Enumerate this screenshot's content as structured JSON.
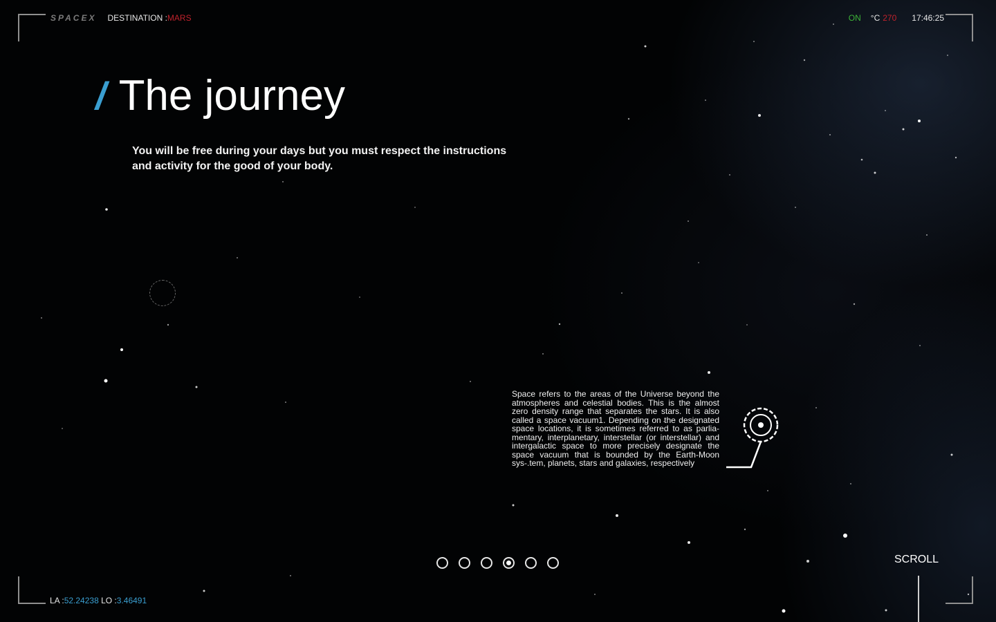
{
  "header": {
    "logo": "SPACEX",
    "destination_label": "DESTINATION :",
    "destination_value": "MARS",
    "status": "ON",
    "temp_unit": "°C",
    "temp_value": "270",
    "time": "17:46:25"
  },
  "hero": {
    "slash": "/",
    "title": "The journey",
    "subtitle": "You will be free during your days but you must respect the instructions and activity for the good of your body."
  },
  "info": {
    "text": "Space refers to the areas of the Universe beyond the atmospheres and celestial bodies. This is the almost zero density range that separates the stars. It is also called a space vacuum1. Depending on the designated space locations, it is sometimes referred to as parlia-mentary, interplanetary, interstellar (or interstellar) and intergalactic space to more precisely designate the space vacuum that is bounded by the Earth-Moon sys-.tem, planets, stars and galaxies, respectively"
  },
  "pagination": {
    "count": 6,
    "active_index": 3
  },
  "footer": {
    "scroll_label": "SCROLL",
    "la_label": "LA :",
    "la_value": "52.24238",
    "lo_label": "LO :",
    "lo_value": "3.46491"
  },
  "colors": {
    "accent_blue": "#3a9ed0",
    "alert_red": "#c0222c",
    "status_green": "#3db538"
  }
}
